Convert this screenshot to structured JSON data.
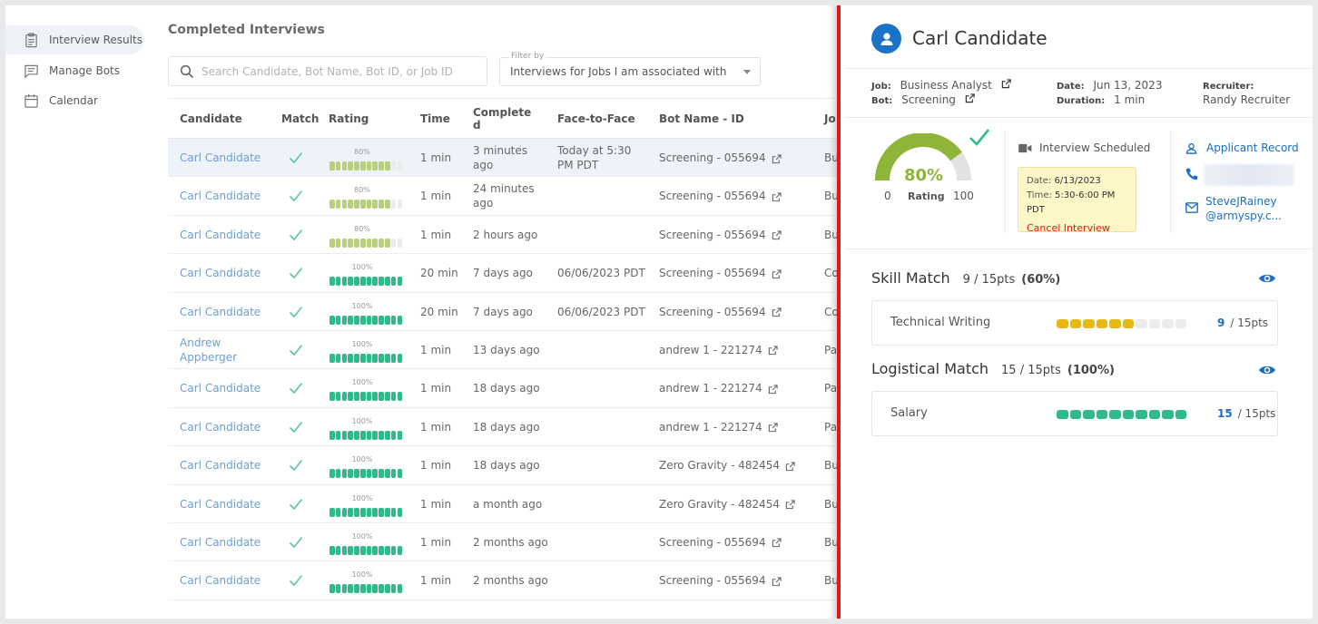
{
  "sidebar": {
    "items": [
      {
        "label": "Interview Results",
        "icon": "clipboard-icon",
        "active": true
      },
      {
        "label": "Manage Bots",
        "icon": "chat-icon",
        "active": false
      },
      {
        "label": "Calendar",
        "icon": "calendar-icon",
        "active": false
      }
    ]
  },
  "main": {
    "title": "Completed Interviews",
    "search_placeholder": "Search Candidate, Bot Name, Bot ID, or Job ID",
    "filter": {
      "label": "Filter by",
      "value": "Interviews for Jobs I am associated with"
    },
    "columns": [
      "Candidate",
      "Match",
      "Rating",
      "Time",
      "Complete d",
      "Face-to-Face",
      "Bot Name - ID",
      "Jo"
    ],
    "rows": [
      {
        "candidate": "Carl Candidate",
        "rating": "80%",
        "rating_value": 0.8,
        "time": "1 min",
        "completed": "3 minutes ago",
        "f2f": "Today at 5:30 PM PDT",
        "bot": "Screening - 055694",
        "job": "Bu"
      },
      {
        "candidate": "Carl Candidate",
        "rating": "80%",
        "rating_value": 0.8,
        "time": "1 min",
        "completed": "24 minutes ago",
        "f2f": "",
        "bot": "Screening - 055694",
        "job": "Bu"
      },
      {
        "candidate": "Carl Candidate",
        "rating": "80%",
        "rating_value": 0.8,
        "time": "1 min",
        "completed": "2 hours ago",
        "f2f": "",
        "bot": "Screening - 055694",
        "job": "Bu"
      },
      {
        "candidate": "Carl Candidate",
        "rating": "100%",
        "rating_value": 1.0,
        "time": "20 min",
        "completed": "7 days ago",
        "f2f": "06/06/2023 PDT",
        "bot": "Screening - 055694",
        "job": "Co"
      },
      {
        "candidate": "Carl Candidate",
        "rating": "100%",
        "rating_value": 1.0,
        "time": "20 min",
        "completed": "7 days ago",
        "f2f": "06/06/2023 PDT",
        "bot": "Screening - 055694",
        "job": "Co"
      },
      {
        "candidate": "Andrew Appberger",
        "rating": "100%",
        "rating_value": 1.0,
        "time": "1 min",
        "completed": "13 days ago",
        "f2f": "",
        "bot": "andrew 1 - 221274",
        "job": "Pa"
      },
      {
        "candidate": "Carl Candidate",
        "rating": "100%",
        "rating_value": 1.0,
        "time": "1 min",
        "completed": "18 days ago",
        "f2f": "",
        "bot": "andrew 1 - 221274",
        "job": "Pa"
      },
      {
        "candidate": "Carl Candidate",
        "rating": "100%",
        "rating_value": 1.0,
        "time": "1 min",
        "completed": "18 days ago",
        "f2f": "",
        "bot": "andrew 1 - 221274",
        "job": "Pa"
      },
      {
        "candidate": "Carl Candidate",
        "rating": "100%",
        "rating_value": 1.0,
        "time": "1 min",
        "completed": "18 days ago",
        "f2f": "",
        "bot": "Zero Gravity - 482454",
        "job": "Bu"
      },
      {
        "candidate": "Carl Candidate",
        "rating": "100%",
        "rating_value": 1.0,
        "time": "1 min",
        "completed": "a month ago",
        "f2f": "",
        "bot": "Zero Gravity - 482454",
        "job": "Bu"
      },
      {
        "candidate": "Carl Candidate",
        "rating": "100%",
        "rating_value": 1.0,
        "time": "1 min",
        "completed": "2 months ago",
        "f2f": "",
        "bot": "Screening - 055694",
        "job": "Bu"
      },
      {
        "candidate": "Carl Candidate",
        "rating": "100%",
        "rating_value": 1.0,
        "time": "1 min",
        "completed": "2 months ago",
        "f2f": "",
        "bot": "Screening - 055694",
        "job": "Bu"
      }
    ]
  },
  "panel": {
    "name": "Carl Candidate",
    "job_label": "Job:",
    "job": "Business Analyst",
    "bot_label": "Bot:",
    "bot": "Screening",
    "date_label": "Date:",
    "date": "Jun 13, 2023",
    "duration_label": "Duration:",
    "duration": "1 min",
    "recruiter_label": "Recruiter:",
    "recruiter": "Randy Recruiter",
    "gauge": {
      "value": 0.8,
      "pct": "80%",
      "min": "0",
      "max": "100",
      "label": "Rating"
    },
    "interview": {
      "status": "Interview Scheduled",
      "date_label": "Date:",
      "date": "6/13/2023",
      "time_label": "Time:",
      "time": "5:30-6:00 PM PDT",
      "cancel": "Cancel Interview"
    },
    "contact": {
      "record": "Applicant Record",
      "email_line1": "SteveJRainey",
      "email_line2": "@armyspy.c..."
    },
    "skill": {
      "title": "Skill Match",
      "score": "9 / 15pts",
      "pct": "(60%)",
      "items": [
        {
          "label": "Technical Writing",
          "filled": 6,
          "total": 10,
          "pts": "9",
          "of": "/ 15pts"
        }
      ]
    },
    "logistical": {
      "title": "Logistical Match",
      "score": "15 / 15pts",
      "pct": "(100%)",
      "items": [
        {
          "label": "Salary",
          "filled": 10,
          "total": 10,
          "pts": "15",
          "of": "/ 15pts"
        }
      ]
    }
  },
  "colors": {
    "accent_blue": "#1a73c7",
    "rating_green": "#8fb43a",
    "full_green": "#2fb98c",
    "skill_yellow": "#e6b818",
    "highlight_red": "#e8151b",
    "cancel_red": "#e21a1a"
  }
}
